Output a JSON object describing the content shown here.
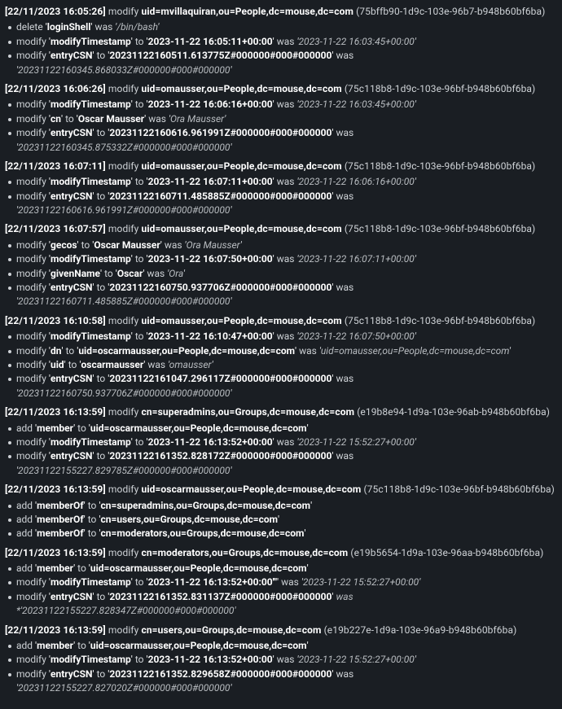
{
  "entries": [
    {
      "ts": "[22/11/2023 16:05:26]",
      "action": "modify",
      "dn": "uid=mvillaquiran,ou=People,dc=mouse,dc=com",
      "uuid": "(75bffb90-1d9c-103e-96b7-b948b60bf6ba)",
      "changes": [
        {
          "op": "delete",
          "attr": "loginShell",
          "old": "/bin/bash"
        },
        {
          "op": "modify",
          "attr": "modifyTimestamp",
          "new": "2023-11-22 16:05:11+00:00",
          "old": "2023-11-22 16:03:45+00:00"
        },
        {
          "op": "modify",
          "attr": "entryCSN",
          "new": "20231122160511.613775Z#000000#000#000000",
          "old": "20231122160345.868033Z#000000#000#000000"
        }
      ]
    },
    {
      "ts": "[22/11/2023 16:06:26]",
      "action": "modify",
      "dn": "uid=omausser,ou=People,dc=mouse,dc=com",
      "uuid": "(75c118b8-1d9c-103e-96bf-b948b60bf6ba)",
      "changes": [
        {
          "op": "modify",
          "attr": "modifyTimestamp",
          "new": "2023-11-22 16:06:16+00:00",
          "old": "2023-11-22 16:03:45+00:00"
        },
        {
          "op": "modify",
          "attr": "cn",
          "new": "Oscar Mausser",
          "old": "Ora Mausser"
        },
        {
          "op": "modify",
          "attr": "entryCSN",
          "new": "20231122160616.961991Z#000000#000#000000",
          "old": "20231122160345.875332Z#000000#000#000000"
        }
      ]
    },
    {
      "ts": "[22/11/2023 16:07:11]",
      "action": "modify",
      "dn": "uid=omausser,ou=People,dc=mouse,dc=com",
      "uuid": "(75c118b8-1d9c-103e-96bf-b948b60bf6ba)",
      "changes": [
        {
          "op": "modify",
          "attr": "modifyTimestamp",
          "new": "2023-11-22 16:07:11+00:00",
          "old": "2023-11-22 16:06:16+00:00"
        },
        {
          "op": "modify",
          "attr": "entryCSN",
          "new": "20231122160711.485885Z#000000#000#000000",
          "old": "20231122160616.961991Z#000000#000#000000"
        }
      ]
    },
    {
      "ts": "[22/11/2023 16:07:57]",
      "action": "modify",
      "dn": "uid=omausser,ou=People,dc=mouse,dc=com",
      "uuid": "(75c118b8-1d9c-103e-96bf-b948b60bf6ba)",
      "changes": [
        {
          "op": "modify",
          "attr": "gecos",
          "new": "Oscar Mausser",
          "old": "Ora Mausser"
        },
        {
          "op": "modify",
          "attr": "modifyTimestamp",
          "new": "2023-11-22 16:07:50+00:00",
          "old": "2023-11-22 16:07:11+00:00"
        },
        {
          "op": "modify",
          "attr": "givenName",
          "new": "Oscar",
          "old": "Ora"
        },
        {
          "op": "modify",
          "attr": "entryCSN",
          "new": "20231122160750.937706Z#000000#000#000000",
          "old": "20231122160711.485885Z#000000#000#000000"
        }
      ]
    },
    {
      "ts": "[22/11/2023 16:10:58]",
      "action": "modify",
      "dn": "uid=omausser,ou=People,dc=mouse,dc=com",
      "uuid": "(75c118b8-1d9c-103e-96bf-b948b60bf6ba)",
      "changes": [
        {
          "op": "modify",
          "attr": "modifyTimestamp",
          "new": "2023-11-22 16:10:47+00:00",
          "old": "2023-11-22 16:07:50+00:00"
        },
        {
          "op": "modify",
          "attr": "dn",
          "new": "uid=oscarmausser,ou=People,dc=mouse,dc=com",
          "old": "uid=omausser,ou=People,dc=mouse,dc=com"
        },
        {
          "op": "modify",
          "attr": "uid",
          "new": "oscarmausser",
          "old": "omausser"
        },
        {
          "op": "modify",
          "attr": "entryCSN",
          "new": "20231122161047.296117Z#000000#000#000000",
          "old": "20231122160750.937706Z#000000#000#000000"
        }
      ]
    },
    {
      "ts": "[22/11/2023 16:13:59]",
      "action": "modify",
      "dn": "cn=superadmins,ou=Groups,dc=mouse,dc=com",
      "uuid": "(e19b8e94-1d9a-103e-96ab-b948b60bf6ba)",
      "changes": [
        {
          "op": "add",
          "attr": "member",
          "new": "uid=oscarmausser,ou=People,dc=mouse,dc=com"
        },
        {
          "op": "modify",
          "attr": "modifyTimestamp",
          "new": "2023-11-22 16:13:52+00:00",
          "old": "2023-11-22 15:52:27+00:00"
        },
        {
          "op": "modify",
          "attr": "entryCSN",
          "new": "20231122161352.828172Z#000000#000#000000",
          "old": "20231122155227.829785Z#000000#000#000000"
        }
      ]
    },
    {
      "ts": "[22/11/2023 16:13:59]",
      "action": "modify",
      "dn": "uid=oscarmausser,ou=People,dc=mouse,dc=com",
      "uuid": "(75c118b8-1d9c-103e-96bf-b948b60bf6ba)",
      "changes": [
        {
          "op": "add",
          "attr": "memberOf",
          "new": "cn=superadmins,ou=Groups,dc=mouse,dc=com"
        },
        {
          "op": "add",
          "attr": "memberOf",
          "new": "cn=users,ou=Groups,dc=mouse,dc=com"
        },
        {
          "op": "add",
          "attr": "memberOf",
          "new": "cn=moderators,ou=Groups,dc=mouse,dc=com"
        }
      ]
    },
    {
      "ts": "[22/11/2023 16:13:59]",
      "action": "modify",
      "dn": "cn=moderators,ou=Groups,dc=mouse,dc=com",
      "uuid": "(e19b5654-1d9a-103e-96aa-b948b60bf6ba)",
      "changes": [
        {
          "op": "add",
          "attr": "member",
          "new": "uid=oscarmausser,ou=People,dc=mouse,dc=com"
        },
        {
          "op": "modify",
          "attr": "modifyTimestamp",
          "new": "2023-11-22 16:13:52+00:00'\"",
          "old": "2023-11-22 15:52:27+00:00"
        },
        {
          "op": "modify",
          "attr": "entryCSN",
          "new": "20231122161352.831137Z#000000#000#000000",
          "old_raw": "was *'20231122155227.828347Z#000000#000#000000'"
        }
      ]
    },
    {
      "ts": "[22/11/2023 16:13:59]",
      "action": "modify",
      "dn": "cn=users,ou=Groups,dc=mouse,dc=com",
      "uuid": "(e19b227e-1d9a-103e-96a9-b948b60bf6ba)",
      "changes": [
        {
          "op": "add",
          "attr": "member",
          "new": "uid=oscarmausser,ou=People,dc=mouse,dc=com"
        },
        {
          "op": "modify",
          "attr": "modifyTimestamp",
          "new": "2023-11-22 16:13:52+00:00",
          "old": "2023-11-22 15:52:27+00:00"
        },
        {
          "op": "modify",
          "attr": "entryCSN",
          "new": "20231122161352.829658Z#000000#000#000000",
          "old": "20231122155227.827020Z#000000#000#000000"
        }
      ]
    }
  ],
  "labels": {
    "was": "was",
    "to": "to"
  }
}
